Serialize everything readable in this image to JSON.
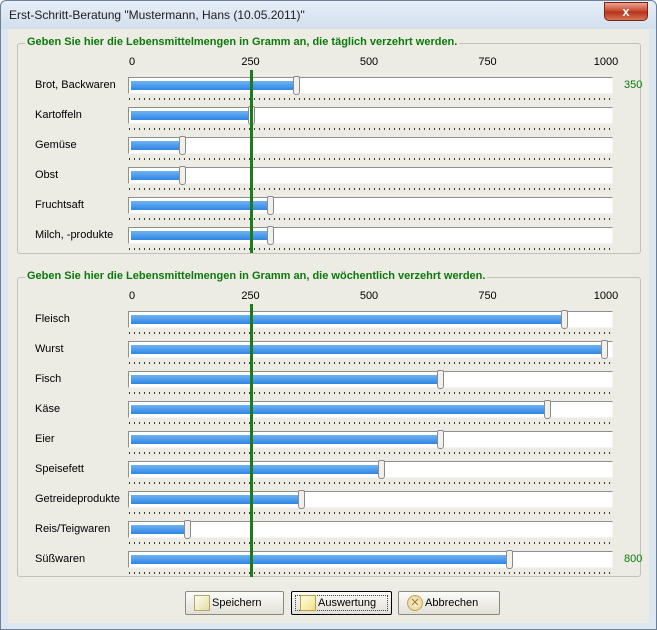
{
  "window": {
    "title": "Erst-Schritt-Beratung \"Mustermann, Hans (10.05.2011)\"",
    "close_glyph": "x"
  },
  "daily": {
    "title": "Geben Sie hier die Lebensmittelmengen in Gramm an, die täglich verzehrt werden.",
    "scale": [
      "0",
      "250",
      "500",
      "750",
      "1000"
    ],
    "max": 1000,
    "reference_value": 250,
    "rows": [
      {
        "label": "Brot, Backwaren",
        "value": 350,
        "value_label": "350"
      },
      {
        "label": "Kartoffeln",
        "value": 255,
        "value_label": ""
      },
      {
        "label": "Gemüse",
        "value": 110,
        "value_label": ""
      },
      {
        "label": "Obst",
        "value": 110,
        "value_label": ""
      },
      {
        "label": "Fruchtsaft",
        "value": 295,
        "value_label": ""
      },
      {
        "label": "Milch, -produkte",
        "value": 295,
        "value_label": ""
      }
    ]
  },
  "weekly": {
    "title": "Geben Sie hier die Lebensmittelmengen in Gramm an, die wöchentlich verzehrt werden.",
    "scale": [
      "0",
      "250",
      "500",
      "750",
      "1000"
    ],
    "max": 1000,
    "reference_value": 250,
    "rows": [
      {
        "label": "Fleisch",
        "value": 915,
        "value_label": ""
      },
      {
        "label": "Wurst",
        "value": 1000,
        "value_label": ""
      },
      {
        "label": "Fisch",
        "value": 655,
        "value_label": ""
      },
      {
        "label": "Käse",
        "value": 880,
        "value_label": ""
      },
      {
        "label": "Eier",
        "value": 655,
        "value_label": ""
      },
      {
        "label": "Speisefett",
        "value": 530,
        "value_label": ""
      },
      {
        "label": "Getreideprodukte",
        "value": 360,
        "value_label": ""
      },
      {
        "label": "Reis/Teigwaren",
        "value": 120,
        "value_label": ""
      },
      {
        "label": "Süßwaren",
        "value": 800,
        "value_label": "800"
      }
    ]
  },
  "buttons": {
    "save": "Speichern",
    "evaluate": "Auswertung",
    "cancel": "Abbrechen"
  },
  "icons": {
    "save": "document-icon",
    "evaluate": "document-icon",
    "cancel": "cancel-icon"
  },
  "colors": {
    "fill": "#2f86e4",
    "reference_line": "#1d7a1d",
    "group_title": "#0b7a0b"
  }
}
